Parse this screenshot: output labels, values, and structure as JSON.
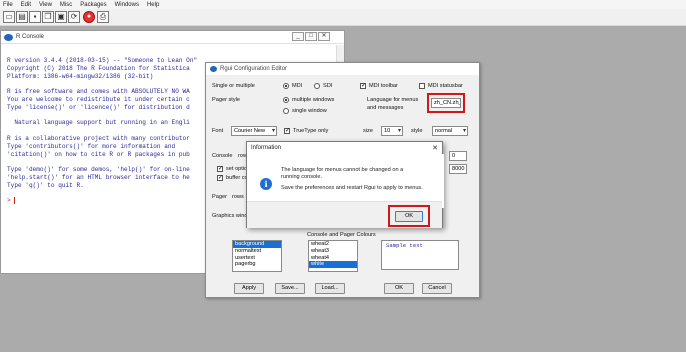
{
  "menubar": [
    "File",
    "Edit",
    "View",
    "Misc",
    "Packages",
    "Windows",
    "Help"
  ],
  "console": {
    "title": "R Console",
    "lines": [
      "R version 3.4.4 (2018-03-15) -- \"Someone to Lean On\"",
      "Copyright (C) 2018 The R Foundation for Statistica",
      "Platform: i386-w64-mingw32/i386 (32-bit)",
      "",
      "R is free software and comes with ABSOLUTELY NO WA",
      "You are welcome to redistribute it under certain c",
      "Type 'license()' or 'licence()' for distribution d",
      "",
      "  Natural language support but running in an Engli",
      "",
      "R is a collaborative project with many contributor",
      "Type 'contributors()' for more information and",
      "'citation()' on how to cite R or R packages in pub",
      "",
      "Type 'demo()' for some demos, 'help()' for on-line",
      "'help.start()' for an HTML browser interface to he",
      "Type 'q()' to quit R.",
      ""
    ],
    "prompt": ">"
  },
  "config": {
    "title": "Rgui Configuration Editor",
    "single_or_multiple_label": "Single or multiple",
    "mdi_label": "MDI",
    "sdi_label": "SDI",
    "mdi_toolbar_label": "MDI toolbar",
    "mdi_statusbar_label": "MDI statusbar",
    "pager_style_label": "Pager style",
    "multiple_windows_label": "multiple windows",
    "single_window_label": "single window",
    "language_label_1": "Language for menus",
    "language_label_2": "and messages",
    "language_value": "zh_CN.zh_CN",
    "font_label": "Font",
    "font_value": "Courier New",
    "truetype_label": "TrueType only",
    "size_label": "size",
    "size_value": "10",
    "style_label": "style",
    "style_value": "normal",
    "console_label": "Console",
    "rows_label": "rows",
    "set_options_label": "set optio",
    "buffer_label": "buffer co",
    "field_a_value": "0",
    "field_b_value": "8000",
    "pager_label": "Pager",
    "pager_rows_label": "rows",
    "graphics_label": "Graphics wind",
    "colours_label": "Console and Pager Colours",
    "colour_items": [
      "background",
      "normaltext",
      "usertext",
      "pagerbg"
    ],
    "palette_items": [
      "wheat2",
      "wheat3",
      "wheat4",
      "white"
    ],
    "sample_text": "Sample text",
    "apply_label": "Apply",
    "save_label": "Save...",
    "load_label": "Load...",
    "ok_label": "OK",
    "cancel_label": "Cancel"
  },
  "info_dialog": {
    "title": "Information",
    "close_glyph": "✕",
    "icon_glyph": "i",
    "message_line1": "The language for menus cannot be changed on a",
    "message_line2": "running console.",
    "message_line3": "Save the preferences and restart Rgui to apply to menus.",
    "ok_label": "OK"
  },
  "icons": [
    "open-icon",
    "load-workspace-icon",
    "save-icon",
    "copy-icon",
    "paste-icon",
    "copy-paste-icon",
    "stop-icon",
    "print-icon"
  ],
  "colors": {
    "highlight_box": "#d01818",
    "console_text": "#2a2a9a",
    "selection": "#1a6fd6",
    "info_icon": "#1f6fd0"
  }
}
